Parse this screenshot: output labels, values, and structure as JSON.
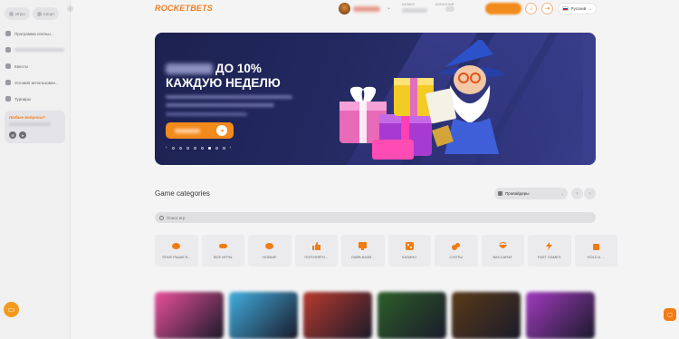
{
  "colors": {
    "accent": "#ef7d1a",
    "banner_bg": "#242a62",
    "page_bg": "#f4f4f5"
  },
  "sidebar": {
    "tabs": [
      {
        "label": "Игры",
        "icon": "gamepad-icon"
      },
      {
        "label": "Спорт",
        "icon": "ball-icon"
      }
    ],
    "items": [
      {
        "label": "Программа лояльн...",
        "icon": "crown-icon"
      },
      {
        "label": "",
        "icon": "star-icon"
      },
      {
        "label": "Квесты",
        "icon": "target-icon"
      },
      {
        "label": "Условия использован...",
        "icon": "document-icon"
      },
      {
        "label": "Турниры",
        "icon": "trophy-icon"
      }
    ],
    "help": {
      "title": "Любые вопросы?",
      "contacts": [
        "email-icon",
        "telegram-icon"
      ]
    },
    "chat_icon": "chat-icon"
  },
  "header": {
    "logo": "ROCKETBETS",
    "balance_label": "БАЛАНС",
    "bonus_label": "БОНУСНЫЙ",
    "language": "Русский"
  },
  "banner": {
    "title_suffix": "ДО 10%",
    "title_line2": "КАЖДУЮ НЕДЕЛЮ",
    "pagination": {
      "total": 8,
      "active_index": 5
    }
  },
  "categories": {
    "title": "Game categories",
    "providers_label": "Провайдеры",
    "search_placeholder": "Поиск игр",
    "items": [
      {
        "label": "ЭТЫЕ РЫШЕ Б...",
        "icon": "orange-badge-icon"
      },
      {
        "label": "ВСЕ ИГРЫ",
        "icon": "gamepad-icon"
      },
      {
        "label": "НОВЫЕ",
        "icon": "new-badge-icon"
      },
      {
        "label": "ПОПУЛЯРН...",
        "icon": "thumbs-up-icon"
      },
      {
        "label": "ЛАЙВ-КАЗИ...",
        "icon": "live-icon"
      },
      {
        "label": "КАЗИНО",
        "icon": "dice-icon"
      },
      {
        "label": "СЛОТЫ",
        "icon": "slot-icon"
      },
      {
        "label": "BACCARAT",
        "icon": "chip-icon"
      },
      {
        "label": "FAST GAMES",
        "icon": "lightning-icon"
      },
      {
        "label": "HOLD & ...",
        "icon": "bag-icon"
      }
    ]
  },
  "games": [
    {
      "color": "#e9509a"
    },
    {
      "color": "#41aee0"
    },
    {
      "color": "#b83a2e"
    },
    {
      "color": "#2d5f2a"
    },
    {
      "color": "#5a3a18"
    },
    {
      "color": "#a23ac0"
    }
  ]
}
